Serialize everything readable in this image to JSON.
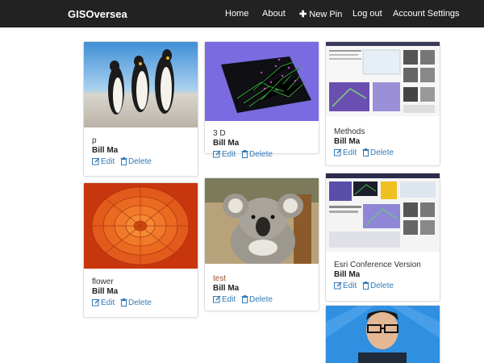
{
  "navbar": {
    "brand": "GISOversea",
    "links": {
      "home": "Home",
      "about": "About",
      "new_pin": "New Pin",
      "logout": "Log out",
      "account": "Account Settings"
    }
  },
  "actions": {
    "edit": "Edit",
    "delete": "Delete"
  },
  "pins": [
    {
      "title": "p",
      "author": "Bill Ma",
      "image": "penguins-photo"
    },
    {
      "title": "3 D",
      "author": "Bill Ma",
      "image": "3d-point-cloud"
    },
    {
      "title": "Methods",
      "author": "Bill Ma",
      "image": "methods-slide"
    },
    {
      "title": "flower",
      "author": "Bill Ma",
      "image": "orange-flower-photo"
    },
    {
      "title": "test",
      "author": "Bill Ma",
      "image": "koala-photo"
    },
    {
      "title": "Esri Conference Version",
      "author": "Bill Ma",
      "image": "conference-poster"
    },
    {
      "title": "",
      "author": "",
      "image": "portrait-photo"
    }
  ],
  "colors": {
    "navbar": "#222222",
    "link": "#337ab7",
    "card_border": "#dddddd"
  }
}
